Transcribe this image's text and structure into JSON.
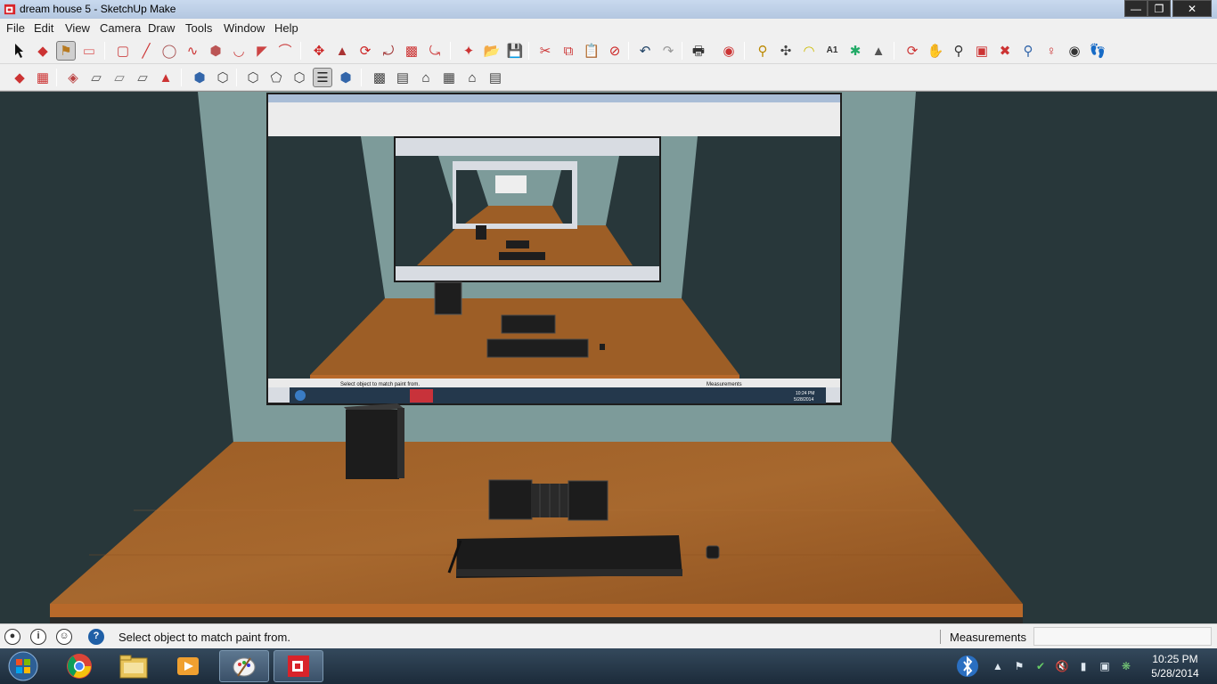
{
  "window": {
    "title": "dream house 5 - SketchUp Make"
  },
  "menu": [
    "File",
    "Edit",
    "View",
    "Camera",
    "Draw",
    "Tools",
    "Window",
    "Help"
  ],
  "status": {
    "hint": "Select object to match paint from.",
    "measurements_label": "Measurements",
    "measurements_value": ""
  },
  "nested_ui": {
    "hint": "Select object to match paint from.",
    "measurements_label": "Measurements",
    "time": "10:24 PM",
    "date": "5/28/2014"
  },
  "taskbar": {
    "time": "10:25 PM",
    "date": "5/28/2014"
  },
  "colors": {
    "wall": "#28373a",
    "desk": "#9a5a23",
    "trim": "#7a9a98",
    "accent_red": "#c8323a"
  }
}
